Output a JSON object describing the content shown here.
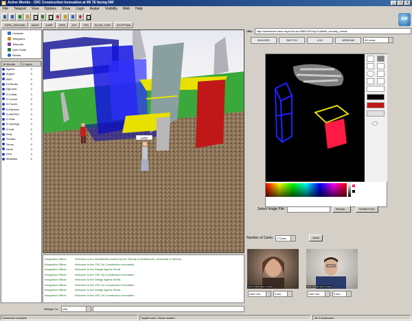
{
  "window": {
    "title": "Active Worlds - CRC Construction Innovation at 4N 7E facing NW"
  },
  "menu": [
    "File",
    "Teleport",
    "View",
    "Options",
    "Show",
    "Login",
    "Avatar",
    "Visibility",
    "Web",
    "Help"
  ],
  "toolbar": {
    "gestures": [
      "TURN_AROUND",
      "WAVE",
      "JUMP",
      "SPIN",
      "JOY",
      "YES",
      "BLOW_KISS",
      "EGYPTIAN"
    ]
  },
  "logo_text": "AW",
  "nav": [
    "Contacts",
    "Telegrams",
    "Teleports",
    "User Guide",
    "Worlds"
  ],
  "userlist": {
    "col_world": "10 Worlds",
    "col_users": "2 Users",
    "rows": [
      {
        "name": "Agents",
        "count": "0"
      },
      {
        "name": "Angkor",
        "count": "0"
      },
      {
        "name": "AWS",
        "count": "0"
      },
      {
        "name": "DCStudio",
        "count": "0"
      },
      {
        "name": "DgCome",
        "count": "0"
      },
      {
        "name": "G-Collab",
        "count": "0"
      },
      {
        "name": "G-Constr",
        "count": "0"
      },
      {
        "name": "G-Fuzzin",
        "count": "0"
      },
      {
        "name": "G-Harbord",
        "count": "0"
      },
      {
        "name": "G-MATRIX",
        "count": "0"
      },
      {
        "name": "G-Shar",
        "count": "0"
      },
      {
        "name": "G-Synergy",
        "count": "0"
      },
      {
        "name": "G-Unit",
        "count": "0"
      },
      {
        "name": "Kelly",
        "count": "0"
      },
      {
        "name": "Theatre",
        "count": "0"
      },
      {
        "name": "Tutors",
        "count": "0"
      },
      {
        "name": "Vamb",
        "count": "0"
      },
      {
        "name": "VDS",
        "count": "0"
      },
      {
        "name": "Websites",
        "count": "0"
      }
    ]
  },
  "avatar_tag": "Larry",
  "chat": [
    {
      "who": "Integration Officer:",
      "msg": "Welcome to the VirtualWorld hosted by the Faculty of Architecture, University of Sydney."
    },
    {
      "who": "Integration Officer:",
      "msg": "Welcome to the CRC for Construction Innovation."
    },
    {
      "who": "Integration Officer:",
      "msg": "Welcome to the Design Agents World."
    },
    {
      "who": "Integration Officer:",
      "msg": "Welcome to the CRC for Construction Innovation."
    },
    {
      "who": "Integration Officer:",
      "msg": "Welcome to the Design Agents World."
    },
    {
      "who": "Integration Officer:",
      "msg": "Welcome to the CRC for Construction Innovation."
    },
    {
      "who": "Integration Officer:",
      "msg": "Welcome to the Design Agents World."
    },
    {
      "who": "Integration Officer:",
      "msg": "Welcome to the CRC for Construction Innovation."
    }
  ],
  "chatbar": {
    "whisper_label": "Whisper To:",
    "whisper_value": "(All)"
  },
  "status": [
    "Download complete",
    "Applet tools: Viewer started",
    "36.3 frames/sec"
  ],
  "web": {
    "url_label": "URL:",
    "url": "http://activeworld.arch.usyd.edu.au:8080/CRC/sp/Collab/d_security_check/",
    "tabs": [
      "BUILDER",
      "SKETCH",
      "LOG",
      "WEBCAM"
    ],
    "view_select": "All views",
    "select_image_label": "Select Image File:",
    "browse_label": "Browse...",
    "submit_label": "Submit Form",
    "cams_label": "Number of Cams:",
    "cams_value": "2 Cams",
    "audio_label": "Audio",
    "cam1_caption": "Cam: 1 Click Here to Close",
    "cam2_caption": "Cam: 2 Click Here to Close",
    "userlist_select": "User List",
    "interval": "5 sec"
  }
}
